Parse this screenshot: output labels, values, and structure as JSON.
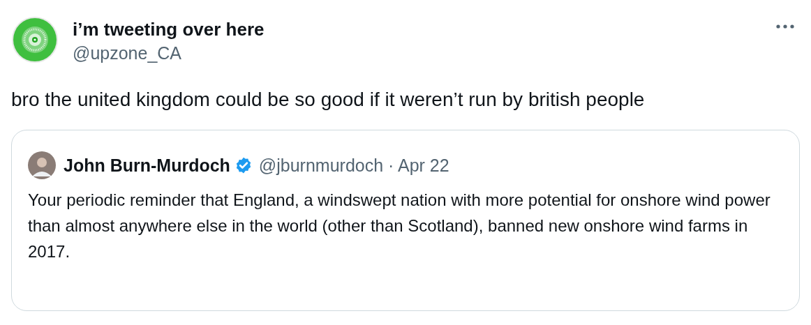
{
  "author": {
    "name": "i’m tweeting over here",
    "handle": "@upzone_CA"
  },
  "text": "bro the united kingdom could be so good if it weren’t run by british people",
  "quoted_tweet": {
    "author": {
      "name": "John Burn-Murdoch",
      "verified": true,
      "handle": "@jburnmurdoch",
      "date": "· Apr 22"
    },
    "text": "Your periodic reminder that England, a windswept nation with more potential for onshore wind power than almost anywhere else in the world (other than Scotland), banned new onshore wind farms in 2017."
  }
}
